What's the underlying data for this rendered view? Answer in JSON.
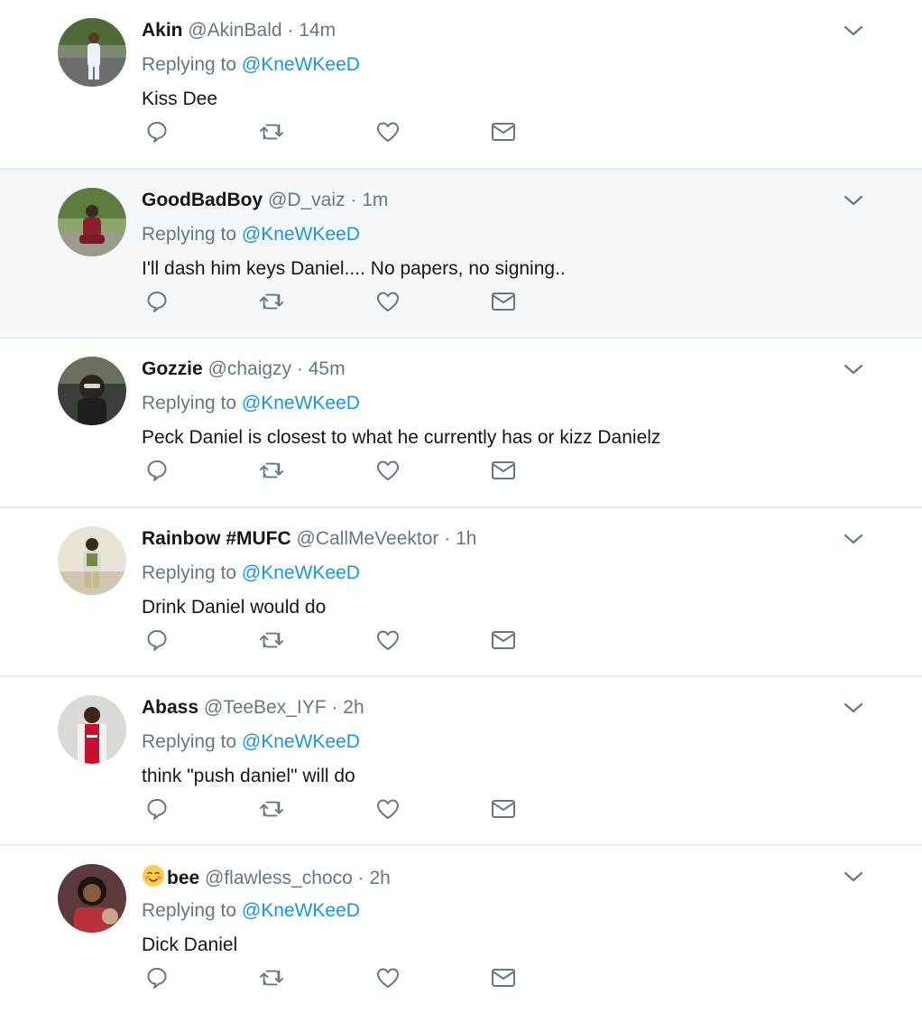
{
  "reply_prefix": "Replying to",
  "colors": {
    "link": "#1b95e0",
    "secondary": "#657786",
    "divider": "#e6ecf0",
    "highlight_bg": "#f5f8fa"
  },
  "icons": {
    "reply": "reply-icon",
    "retweet": "retweet-icon",
    "like": "heart-icon",
    "dm": "envelope-icon",
    "menu": "chevron-down-icon"
  },
  "tweets": [
    {
      "name": "Akin",
      "handle": "@AkinBald",
      "dot": "·",
      "time": "14m",
      "replying_to": "@KneWKeeD",
      "text": "Kiss Dee",
      "highlighted": false
    },
    {
      "name": "GoodBadBoy",
      "handle": "@D_vaiz",
      "dot": "·",
      "time": "1m",
      "replying_to": "@KneWKeeD",
      "text": "I'll dash him keys Daniel.... No papers, no signing..",
      "highlighted": true
    },
    {
      "name": "Gozzie",
      "handle": "@chaigzy",
      "dot": "·",
      "time": "45m",
      "replying_to": "@KneWKeeD",
      "text": "Peck Daniel is closest to what he currently has or kizz Danielz",
      "highlighted": false
    },
    {
      "name": "Rainbow #MUFC",
      "handle": "@CallMeVeektor",
      "dot": "·",
      "time": "1h",
      "replying_to": "@KneWKeeD",
      "text": "Drink Daniel would do",
      "highlighted": false
    },
    {
      "name": "Abass",
      "handle": "@TeeBex_IYF",
      "dot": "·",
      "time": "2h",
      "replying_to": "@KneWKeeD",
      "text": "think \"push daniel\" will do",
      "highlighted": false
    },
    {
      "name": "bee",
      "name_emoji": "smiling-blushing-face-emoji",
      "handle": "@flawless_choco",
      "dot": "·",
      "time": "2h",
      "replying_to": "@KneWKeeD",
      "text": "Dick Daniel",
      "highlighted": false
    }
  ]
}
